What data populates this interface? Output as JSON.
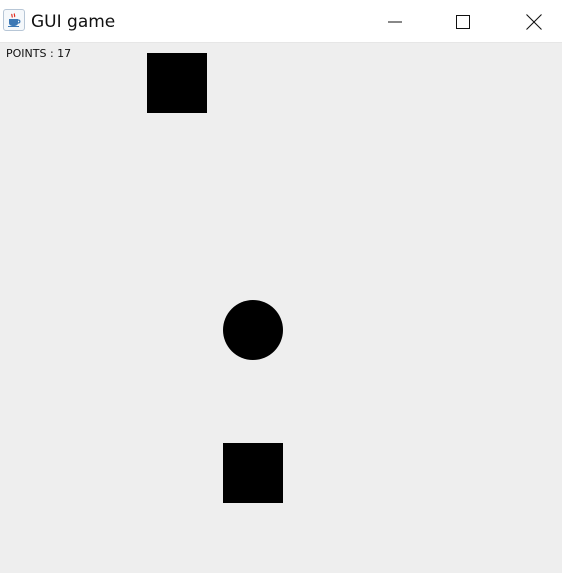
{
  "window": {
    "title": "GUI game",
    "icon": "java-cup-icon",
    "controls": [
      "minimize-icon",
      "maximize-icon",
      "close-icon"
    ]
  },
  "game": {
    "score_text": "POINTS : 17",
    "background_color": "#eeeeee",
    "object_color": "#000000",
    "objects": [
      {
        "type": "square-block",
        "name": "block-top"
      },
      {
        "type": "circle-ball",
        "name": "ball"
      },
      {
        "type": "square-block",
        "name": "block-bottom"
      }
    ]
  }
}
